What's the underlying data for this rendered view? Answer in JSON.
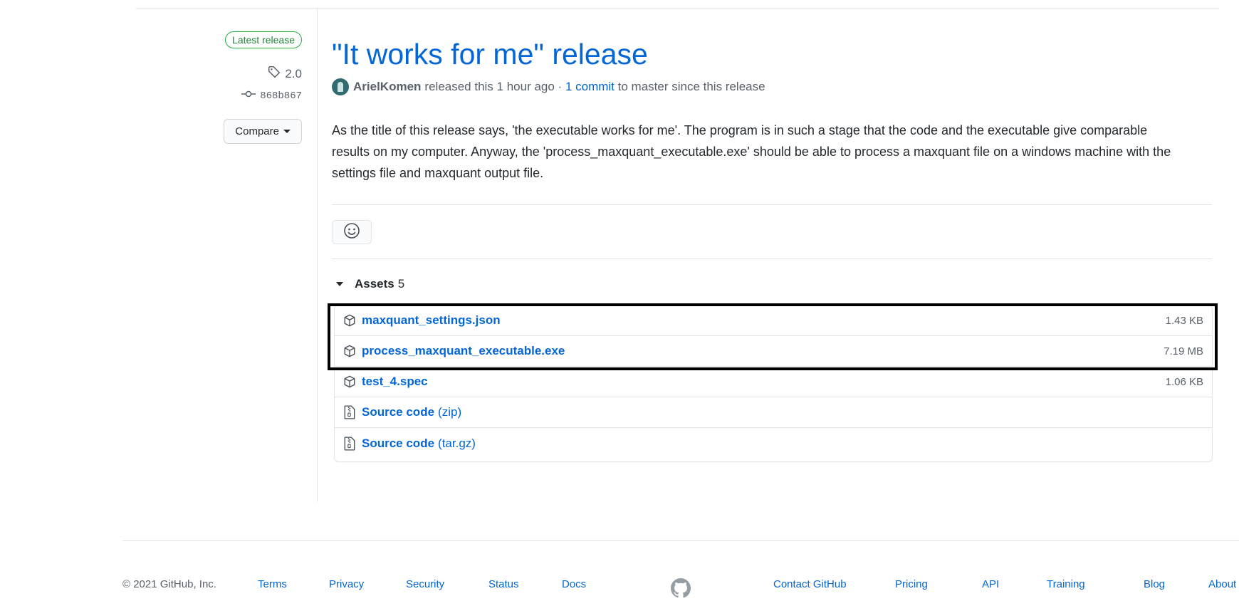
{
  "sidebar": {
    "badge": "Latest release",
    "tag": "2.0",
    "commit": "868b867",
    "compare_label": "Compare"
  },
  "release": {
    "title": "\"It works for me\" release",
    "author": "ArielKomen",
    "released_text": "released this 1 hour ago · ",
    "commit_link": "1 commit",
    "since_text": " to master since this release",
    "body": "As the title of this release says, 'the executable works for me'. The program is in such a stage that the code and the executable give comparable results on my computer. Anyway, the 'process_maxquant_executable.exe' should be able to process a maxquant file on a windows machine with the settings file and maxquant output file."
  },
  "assets": {
    "label": "Assets",
    "count": "5",
    "items": [
      {
        "name": "maxquant_settings.json",
        "size": "1.43 KB",
        "icon": "package-icon"
      },
      {
        "name": "process_maxquant_executable.exe",
        "size": "7.19 MB",
        "icon": "package-icon"
      },
      {
        "name": "test_4.spec",
        "size": "1.06 KB",
        "icon": "package-icon"
      },
      {
        "name": "Source code",
        "ext": "(zip)",
        "icon": "file-zip-icon"
      },
      {
        "name": "Source code",
        "ext": "(tar.gz)",
        "icon": "file-zip-icon"
      }
    ]
  },
  "footer": {
    "copyright": "© 2021 GitHub, Inc.",
    "links": [
      "Terms",
      "Privacy",
      "Security",
      "Status",
      "Docs",
      "Contact GitHub",
      "Pricing",
      "API",
      "Training",
      "Blog",
      "About"
    ]
  },
  "colors": {
    "link": "#0366d6",
    "badge_green": "#28a745",
    "muted": "#586069",
    "highlight_border": "#000000"
  }
}
